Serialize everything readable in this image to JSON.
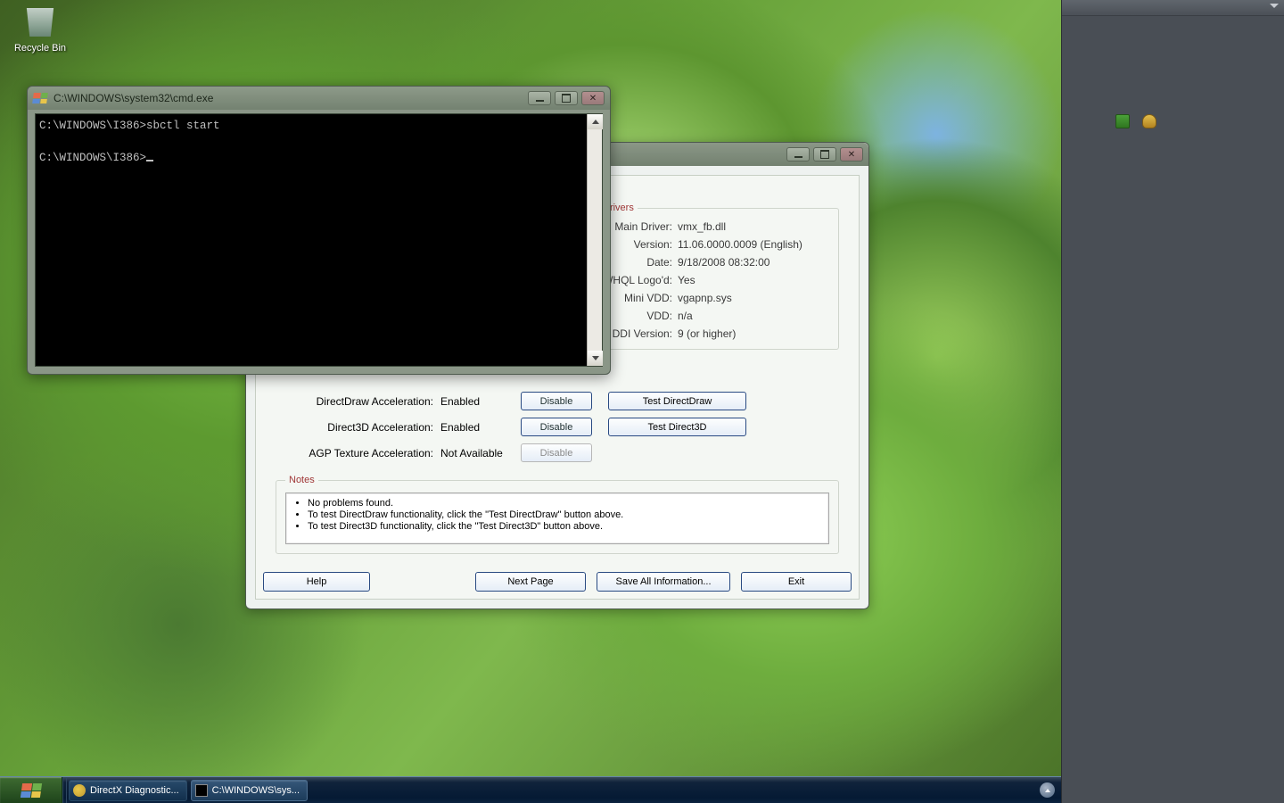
{
  "desktop": {
    "recycle_bin": "Recycle Bin"
  },
  "taskbar": {
    "btn1": "DirectX Diagnostic...",
    "btn2": "C:\\WINDOWS\\sys..."
  },
  "cmd": {
    "title": "C:\\WINDOWS\\system32\\cmd.exe",
    "line1": "C:\\WINDOWS\\I386>sbctl start",
    "line2": "C:\\WINDOWS\\I386>"
  },
  "dx": {
    "drivers": {
      "legend": "Drivers",
      "main_driver_k": "Main Driver:",
      "main_driver_v": "vmx_fb.dll",
      "version_k": "Version:",
      "version_v": "11.06.0000.0009 (English)",
      "date_k": "Date:",
      "date_v": "9/18/2008 08:32:00",
      "whql_k": "WHQL Logo'd:",
      "whql_v": "Yes",
      "minivdd_k": "Mini VDD:",
      "minivdd_v": "vgapnp.sys",
      "vdd_k": "VDD:",
      "vdd_v": "n/a",
      "ddi_k": "DDI Version:",
      "ddi_v": "9 (or higher)"
    },
    "features": {
      "ddraw_k": "DirectDraw Acceleration:",
      "ddraw_v": "Enabled",
      "d3d_k": "Direct3D Acceleration:",
      "d3d_v": "Enabled",
      "agp_k": "AGP Texture Acceleration:",
      "agp_v": "Not Available",
      "disable": "Disable",
      "test_ddraw": "Test DirectDraw",
      "test_d3d": "Test Direct3D"
    },
    "notes": {
      "legend": "Notes",
      "n1": "No problems found.",
      "n2": "To test DirectDraw functionality, click the \"Test DirectDraw\" button above.",
      "n3": "To test Direct3D functionality, click the \"Test Direct3D\" button above."
    },
    "buttons": {
      "help": "Help",
      "next": "Next Page",
      "save": "Save All Information...",
      "exit": "Exit"
    }
  }
}
